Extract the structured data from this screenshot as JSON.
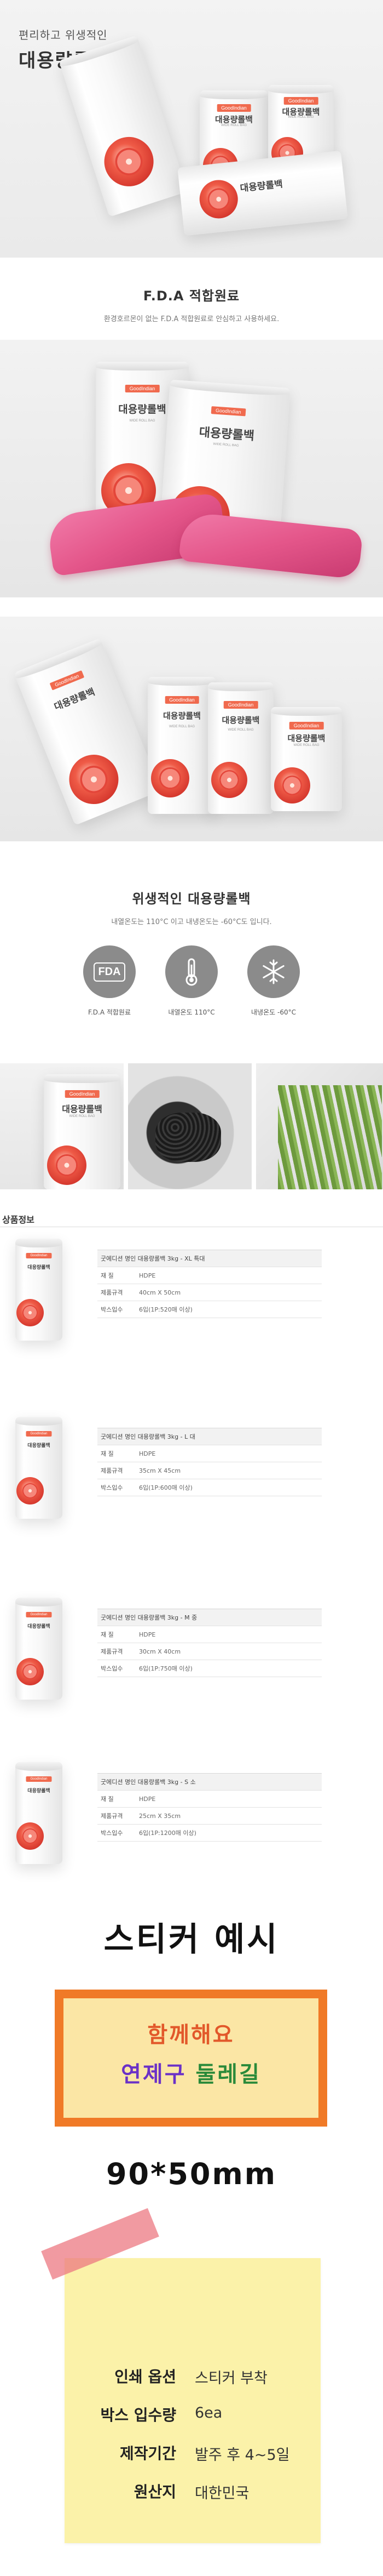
{
  "hero": {
    "subtitle": "편리하고 위생적인",
    "title": "대용량롤백"
  },
  "product_roll": {
    "brand_tag": "GoodIndian",
    "name": "대용량롤백",
    "sub": "WIDE ROLL BAG"
  },
  "fda": {
    "title": "F.D.A 적합원료",
    "desc": "환경호르몬이 없는 F.D.A 적합원료로 안심하고 사용하세요."
  },
  "hygiene": {
    "title": "위생적인 대용량롤백",
    "desc": "내열온도는 110°C 이고 내냉온도는 -60°C도 입니다.",
    "icons": [
      {
        "icon": "fda-icon",
        "label": "F.D.A 적합원료",
        "mark": "FDA"
      },
      {
        "icon": "thermometer-icon",
        "label": "내열온도 110°C",
        "mark": "110°C"
      },
      {
        "icon": "snowflake-icon",
        "label": "내냉온도 -60°C",
        "mark": "-60°C"
      }
    ]
  },
  "product_info": {
    "section_title": "상품정보",
    "items": [
      {
        "name": "굿에디션 명인 대용량롤백 3kg - XL 특대",
        "rows": [
          {
            "k": "재     질",
            "v": "HDPE"
          },
          {
            "k": "제품규격",
            "v": "40cm X 50cm"
          },
          {
            "k": "박스입수",
            "v": "6입(1P:520매 이상)"
          }
        ]
      },
      {
        "name": "굿에디션 명인 대용량롤백 3kg - L 대",
        "rows": [
          {
            "k": "재     질",
            "v": "HDPE"
          },
          {
            "k": "제품규격",
            "v": "35cm X 45cm"
          },
          {
            "k": "박스입수",
            "v": "6입(1P:600매 이상)"
          }
        ]
      },
      {
        "name": "굿에디션 명인 대용량롤백 3kg - M 중",
        "rows": [
          {
            "k": "재     질",
            "v": "HDPE"
          },
          {
            "k": "제품규격",
            "v": "30cm X 40cm"
          },
          {
            "k": "박스입수",
            "v": "6입(1P:750매 이상)"
          }
        ]
      },
      {
        "name": "굿에디션 명인 대용량롤백 3kg - S 소",
        "rows": [
          {
            "k": "재     질",
            "v": "HDPE"
          },
          {
            "k": "제품규격",
            "v": "25cm X 35cm"
          },
          {
            "k": "박스입수",
            "v": "6입(1P:1200매 이상)"
          }
        ]
      }
    ]
  },
  "sticker": {
    "title": "스티커 예시",
    "line1": "함께해요",
    "line2_a": "연제구",
    "line2_b": "둘레길",
    "size": "90*50mm",
    "colors": {
      "orange": "#f07a27",
      "cream": "#fbe6a5",
      "purple": "#6b31c7",
      "green": "#2a8a3a",
      "note": "#fbf2a9"
    }
  },
  "order_info": {
    "rows": [
      {
        "k": "인쇄 옵션",
        "v": "스티커 부착"
      },
      {
        "k": "박스 입수량",
        "v": "6ea"
      },
      {
        "k": "제작기간",
        "v": "발주 후 4~5일"
      },
      {
        "k": "원산지",
        "v": "대한민국"
      }
    ]
  }
}
